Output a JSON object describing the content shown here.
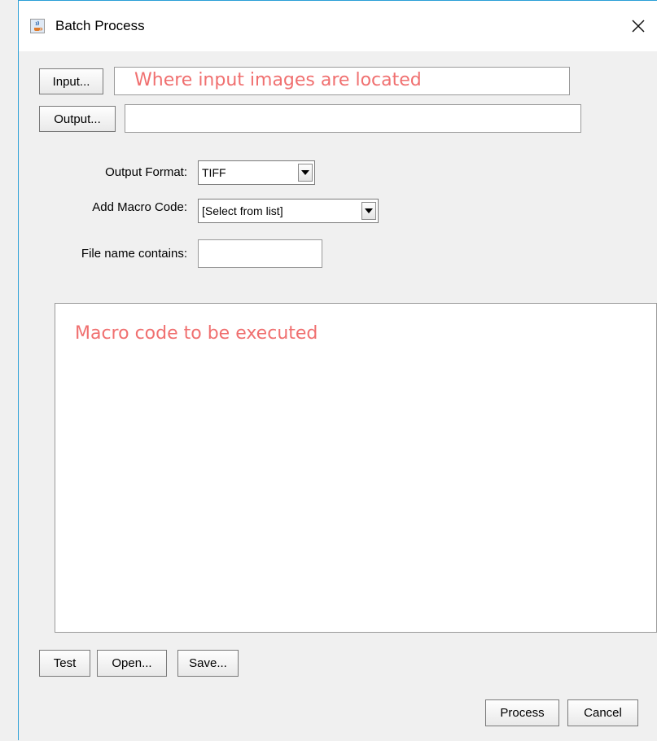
{
  "window": {
    "title": "Batch Process",
    "close_glyph": "✕",
    "icon": "java-cup-icon",
    "accent_color": "#2a9fd6"
  },
  "input": {
    "button_label": "Input...",
    "value": "Where input images are located"
  },
  "output": {
    "button_label": "Output...",
    "value": ""
  },
  "output_format": {
    "label": "Output Format:",
    "selected": "TIFF"
  },
  "macro_code": {
    "label": "Add Macro Code:",
    "selected": "[Select from list]"
  },
  "file_filter": {
    "label": "File name contains:",
    "value": ""
  },
  "macro_editor": {
    "text": "Macro code to be executed"
  },
  "actions": {
    "test": "Test",
    "open": "Open...",
    "save": "Save...",
    "process": "Process",
    "cancel": "Cancel"
  },
  "annotation_color": "#f07070"
}
